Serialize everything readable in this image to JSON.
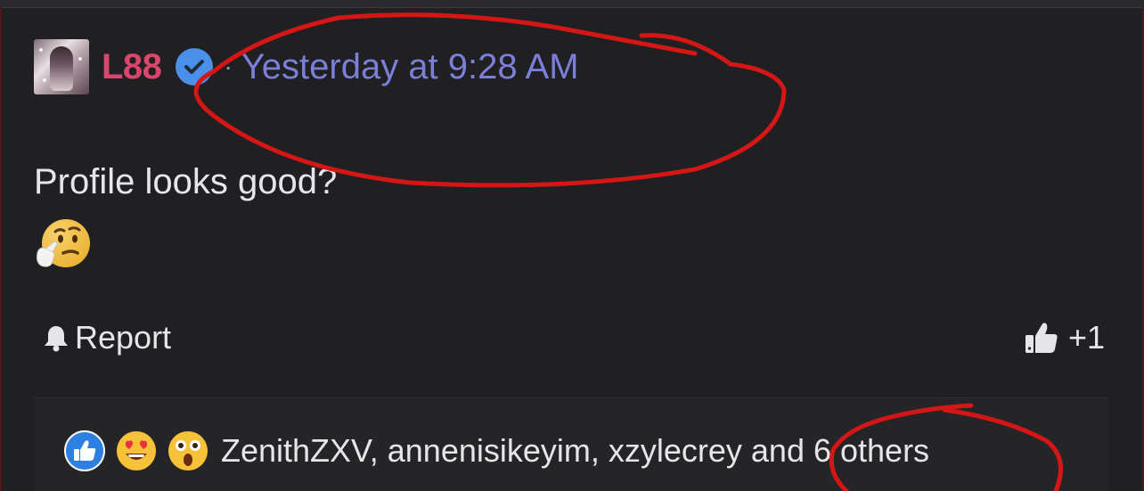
{
  "post": {
    "author": "L88",
    "separator": "·",
    "timestamp": "Yesterday at 9:28 AM",
    "message": "Profile looks good?",
    "emoji": "thinking-face"
  },
  "actions": {
    "report_label": "Report",
    "like_count": "+1"
  },
  "reactions": {
    "icons": [
      "like",
      "heart-eyes",
      "astonished"
    ],
    "summary": "ZenithZXV, annenisikeyim, xzylecrey and 6 others"
  },
  "colors": {
    "background": "#201f21",
    "username": "#d9456b",
    "timestamp": "#7b7fd8",
    "verified": "#4a8fe8",
    "annotation": "#d41616"
  }
}
